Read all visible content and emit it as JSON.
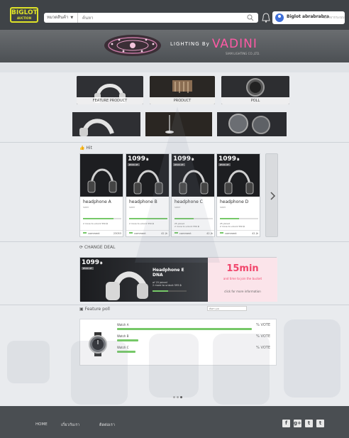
{
  "header": {
    "logo_text": "BIGLOT",
    "logo_sub": "AUCTION",
    "category_select": "หมวดสินค้า",
    "search_placeholder": "ค้นหา",
    "username": "Biglot abrabrabra",
    "logout_label": "ออกจากระบบ"
  },
  "banner": {
    "prefix": "LIGHTING By",
    "brand": "VADINI",
    "sub": "SIAM LIGHTING CO.,LTD."
  },
  "categories": {
    "feature": "FEATURE PRODUCT",
    "product": "PRODUCT",
    "poll": "POLL"
  },
  "sections": {
    "hit": "Hit",
    "hot_deal": "CHANGE DEAL",
    "feature_poll": "Feature poll",
    "poll_search_placeholder": "ค้นหา poll"
  },
  "products": [
    {
      "name": "headphone A",
      "sub": "SONY",
      "price": "",
      "unit": "",
      "old_price": "",
      "progress": 0.8,
      "info1": "",
      "info2": "2 more to unlock 550 ฿",
      "comments": "comment",
      "likes": "23053"
    },
    {
      "name": "headphone B",
      "sub": "SONY",
      "price": "1099",
      "unit": "฿",
      "old_price": "฿500 off",
      "progress": 1.0,
      "info1": "",
      "info2": "2 more to unlock 550 ฿",
      "comments": "comment",
      "likes": "42 Jh"
    },
    {
      "name": "headphone C",
      "sub": "SONY",
      "price": "1099",
      "unit": "฿",
      "old_price": "฿500 off",
      "progress": 0.5,
      "info1": "25 joined",
      "info2": "2 more to unlock 550 ฿",
      "comments": "comment",
      "likes": "42 Jh"
    },
    {
      "name": "headphone D",
      "sub": "SONY",
      "price": "1099",
      "unit": "฿",
      "old_price": "฿500 off",
      "progress": 0.5,
      "info1": "25 joined",
      "info2": "2 more to unlock 550 ฿",
      "comments": "comment",
      "likes": "42 Jh"
    }
  ],
  "deal": {
    "price": "1099",
    "unit": "฿",
    "old_price": "฿500 off",
    "name": "Headphone E",
    "name2": "DNA",
    "info1": "of 25 joined",
    "info2": "2 more to unlock 595 ฿",
    "progress": 0.45,
    "time": "15min",
    "join": "and time to join the bucket",
    "more": "click for more information"
  },
  "poll": {
    "rows": [
      {
        "label": "Watch A",
        "vote": "% VOTE",
        "share": 0.83
      },
      {
        "label": "Watch B",
        "vote": "% VOTE",
        "share": 0.14
      },
      {
        "label": "Watch C",
        "vote": "% VOTE",
        "share": 0.12
      }
    ]
  },
  "footer": {
    "home": "HOME",
    "about": "เกี่ยวกับเรา",
    "contact": "ติดต่อเรา",
    "social": [
      "f",
      "g+",
      "t",
      "t"
    ]
  },
  "colors": {
    "header_bg": "#3f4347",
    "accent_green": "#76c868",
    "accent_pink": "#f1456b",
    "logo_yellow": "#dfe327"
  }
}
